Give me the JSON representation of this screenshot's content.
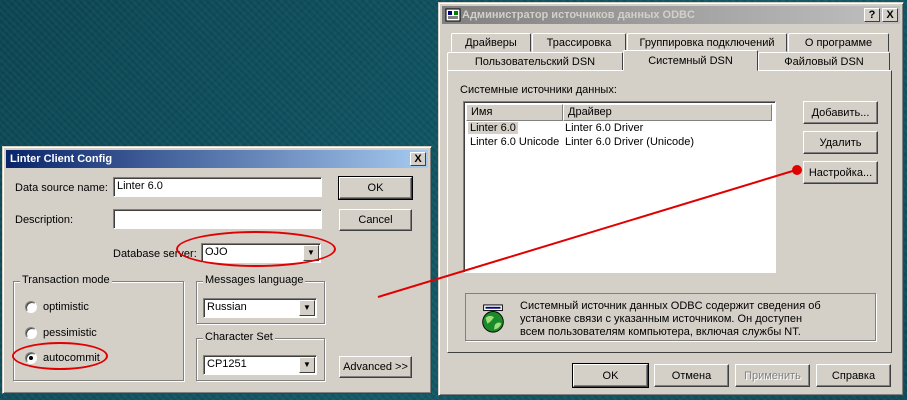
{
  "odbc": {
    "title": "Администратор источников данных ODBC",
    "help_btn": "?",
    "close_btn": "X",
    "tabs_row1": [
      "Драйверы",
      "Трассировка",
      "Группировка подключений",
      "О программе"
    ],
    "tabs_row2": [
      "Пользовательский DSN",
      "Системный DSN",
      "Файловый DSN"
    ],
    "active_tab": "Системный DSN",
    "list_caption": "Системные источники данных:",
    "columns": [
      "Имя",
      "Драйвер"
    ],
    "rows": [
      {
        "name": "Linter 6.0",
        "driver": "Linter 6.0 Driver"
      },
      {
        "name": "Linter 6.0 Unicode",
        "driver": "Linter 6.0 Driver (Unicode)"
      }
    ],
    "add_btn": "Добавить...",
    "remove_btn": "Удалить",
    "config_btn": "Настройка...",
    "info_text": "Системный источник данных ODBC содержит сведения об установке связи с указанным источником. Он доступен всем пользователям компьютера, включая службы NT.",
    "ok_btn": "OK",
    "cancel_btn": "Отмена",
    "apply_btn": "Применить",
    "help_button": "Справка"
  },
  "linter": {
    "title": "Linter Client Config",
    "close_btn": "X",
    "dsn_label": "Data source name:",
    "dsn_value": "Linter 6.0",
    "desc_label": "Description:",
    "desc_value": "",
    "server_label": "Database server:",
    "server_value": "OJO",
    "ok_btn": "OK",
    "cancel_btn": "Cancel",
    "advanced_btn": "Advanced >>",
    "txn_group": "Transaction mode",
    "txn_options": [
      "optimistic",
      "pessimistic",
      "autocommit"
    ],
    "txn_selected": "autocommit",
    "msg_group": "Messages language",
    "msg_value": "Russian",
    "charset_group": "Character Set",
    "charset_value": "CP1251"
  },
  "colors": {
    "annotation": "#e00000",
    "title_active": "#0a246a"
  }
}
